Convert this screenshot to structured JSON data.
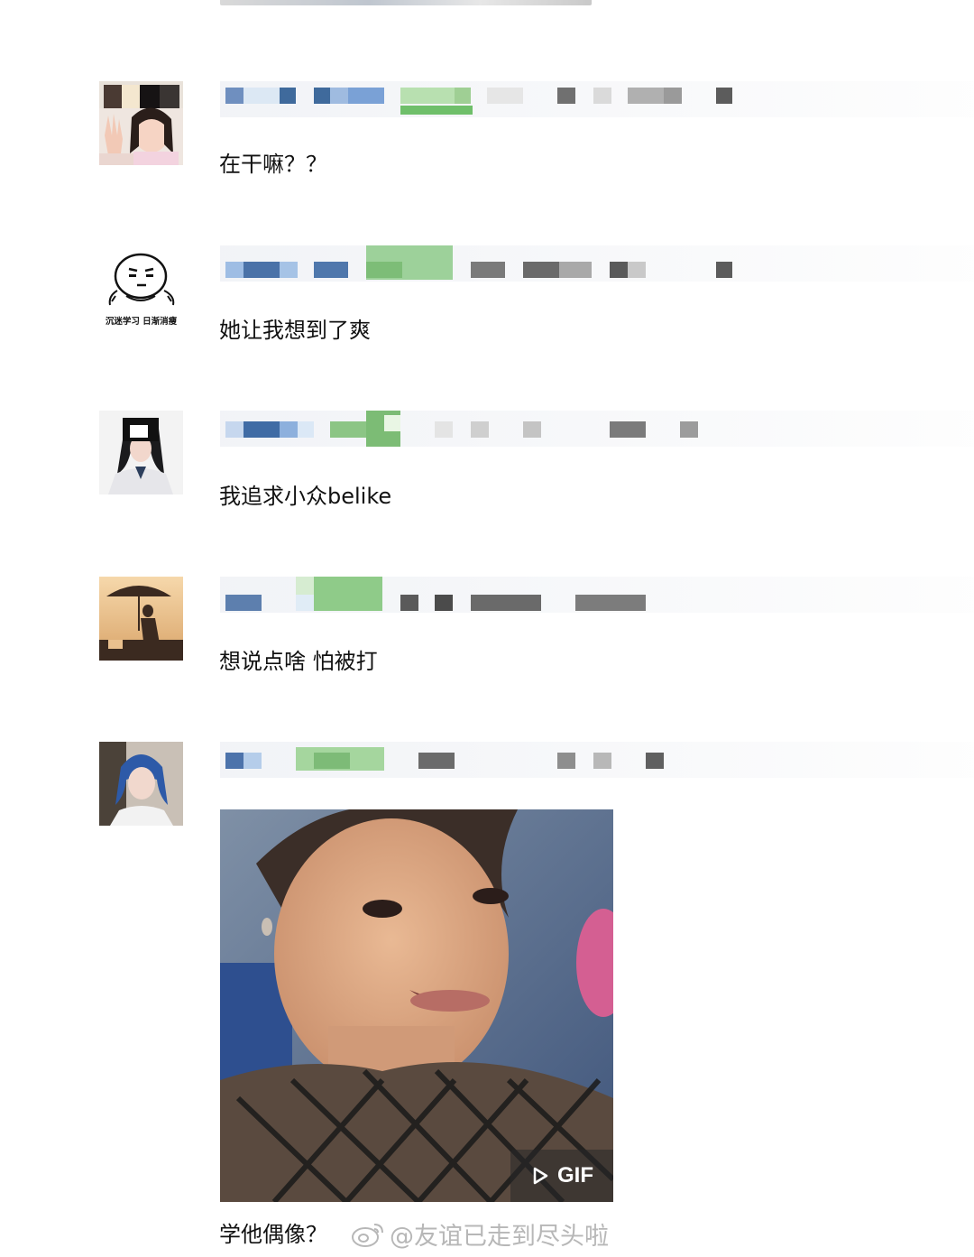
{
  "comments": [
    {
      "text": "在干嘛？？"
    },
    {
      "text": "她让我想到了爽",
      "avatar_caption": "沉迷学习 日渐消瘦"
    },
    {
      "text": "我追求小众belike"
    },
    {
      "text": "想说点啥 怕被打"
    },
    {
      "text": "学他偶像？",
      "media": {
        "type": "GIF",
        "badge_label": "GIF",
        "badge_icon": "play-icon"
      }
    }
  ],
  "watermark": {
    "text": "@友谊已走到尽头啦",
    "icon": "weibo-logo-icon"
  },
  "colors": {
    "background": "#ffffff",
    "text": "#111111",
    "username_blur_blue": "#4a70a6",
    "username_blur_green": "#7fbf6f"
  }
}
